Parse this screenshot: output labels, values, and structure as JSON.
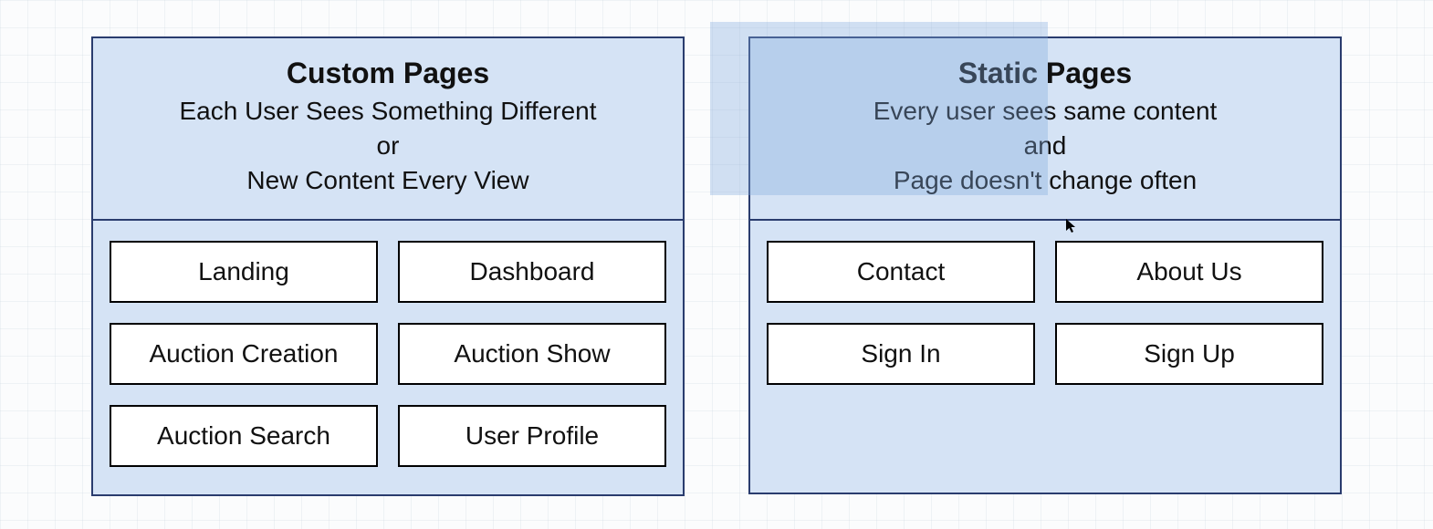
{
  "panels": {
    "custom": {
      "title": "Custom Pages",
      "sub1": "Each User Sees Something Different",
      "sub2": "or",
      "sub3": "New Content Every View",
      "items": [
        "Landing",
        "Dashboard",
        "Auction Creation",
        "Auction Show",
        "Auction Search",
        "User Profile"
      ]
    },
    "static": {
      "title": "Static Pages",
      "sub1": "Every user sees same content",
      "sub2": "and",
      "sub3": "Page doesn't change often",
      "items": [
        "Contact",
        "About Us",
        "Sign In",
        "Sign Up"
      ]
    }
  }
}
